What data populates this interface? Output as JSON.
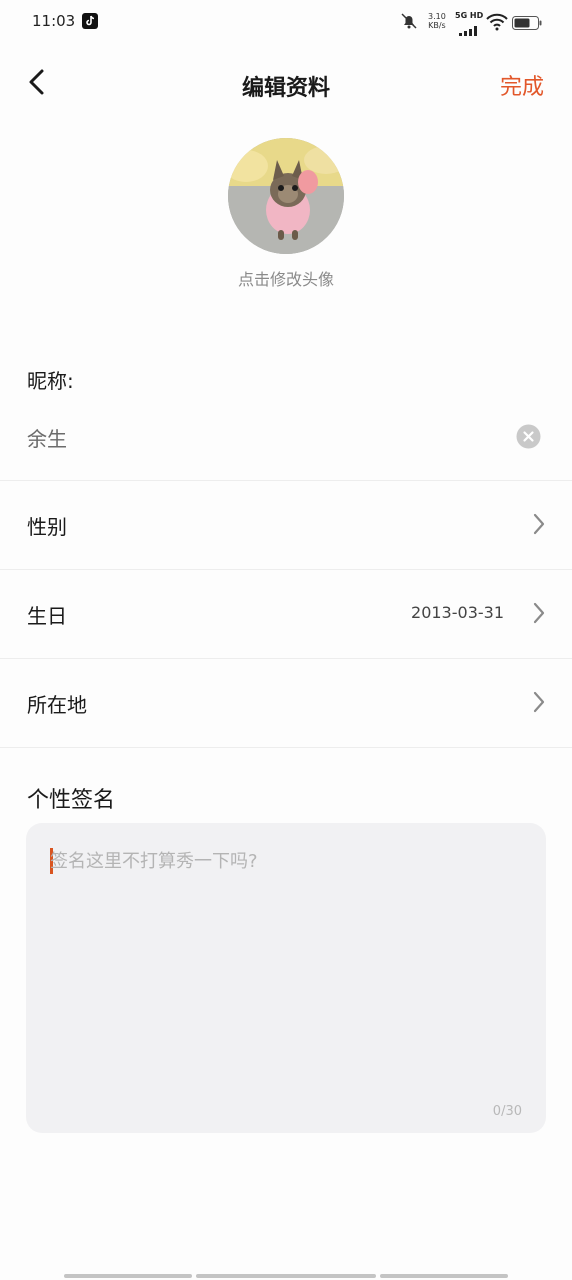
{
  "status_bar": {
    "time": "11:03",
    "net_speed_value": "3.10",
    "net_speed_unit": "KB/s",
    "network_type": "5G HD",
    "icons": [
      "tiktok-icon",
      "bell-muted-icon",
      "signal-icon",
      "wifi-icon",
      "battery-icon"
    ]
  },
  "nav": {
    "title": "编辑资料",
    "done_label": "完成",
    "back_icon": "back-arrow-icon"
  },
  "avatar": {
    "hint": "点击修改头像"
  },
  "nickname": {
    "label": "昵称:",
    "value": "余生"
  },
  "rows": [
    {
      "label": "性别",
      "value": ""
    },
    {
      "label": "生日",
      "value": "2013-03-31"
    },
    {
      "label": "所在地",
      "value": ""
    }
  ],
  "signature": {
    "label": "个性签名",
    "placeholder": "签名这里不打算秀一下吗?",
    "counter": "0/30"
  },
  "colors": {
    "accent": "#e2572a",
    "caret": "#d9541f",
    "input_bg": "#f1f1f3",
    "page_bg": "#fdfdfd"
  }
}
